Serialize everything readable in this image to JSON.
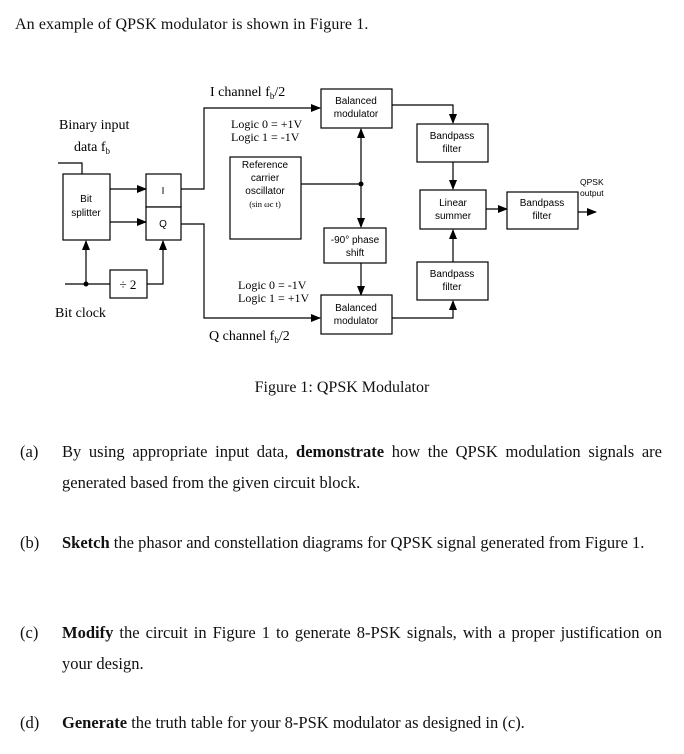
{
  "intro": "An example of QPSK modulator is shown in Figure 1.",
  "figure": {
    "caption": "Figure 1: QPSK Modulator",
    "labels": {
      "binary_input_line1": "Binary input",
      "binary_input_line2": "data f",
      "binary_input_sub": "b",
      "bit_clock": "Bit clock",
      "i_channel": "I channel  f",
      "i_channel_sub": "b",
      "i_channel_suffix": "/2",
      "q_channel": "Q channel  f",
      "q_channel_sub": "b",
      "q_channel_suffix": "/2",
      "i_logic0": "Logic 0 = +1V",
      "i_logic1": "Logic 1 = -1V",
      "q_logic0": "Logic 0 = -1V",
      "q_logic1": "Logic 1 = +1V",
      "qpsk_output_line1": "QPSK",
      "qpsk_output_line2": "output"
    },
    "blocks": {
      "bit_splitter": [
        "Bit",
        "splitter"
      ],
      "i_latch": "I",
      "q_latch": "Q",
      "divider": "÷  2",
      "ref_oscillator": [
        "Reference",
        "carrier",
        "oscillator",
        "(sin ωc t)"
      ],
      "balanced_mod_top": [
        "Balanced",
        "modulator"
      ],
      "balanced_mod_bottom": [
        "Balanced",
        "modulator"
      ],
      "phase_shift": [
        "-90° phase",
        "shift"
      ],
      "bpf_top": [
        "Bandpass",
        "filter"
      ],
      "bpf_bottom": [
        "Bandpass",
        "filter"
      ],
      "linear_summer": [
        "Linear",
        "summer"
      ],
      "bpf_output": [
        "Bandpass",
        "filter"
      ]
    }
  },
  "questions": [
    {
      "label": "(a)",
      "pre": "By using appropriate input data, ",
      "bold": "demonstrate",
      "post": " how the QPSK modulation signals are generated based from the given circuit block."
    },
    {
      "label": "(b)",
      "pre": "",
      "bold": "Sketch",
      "post": " the phasor and constellation diagrams for QPSK signal generated from Figure 1."
    },
    {
      "label": "(c)",
      "pre": "",
      "bold": "Modify",
      "post": " the circuit in Figure 1 to generate 8-PSK signals, with a proper justification on your design."
    },
    {
      "label": "(d)",
      "pre": "",
      "bold": "Generate",
      "post": " the truth table for your 8-PSK modulator as designed in (c)."
    }
  ]
}
